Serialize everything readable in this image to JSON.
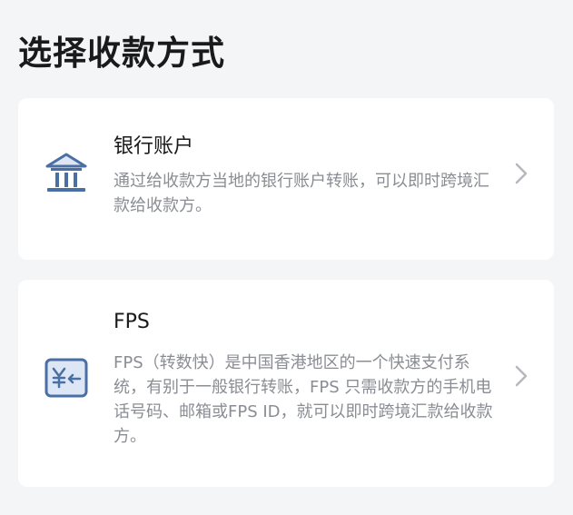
{
  "page": {
    "title": "选择收款方式"
  },
  "methods": [
    {
      "icon": "bank-icon",
      "title": "银行账户",
      "description": "通过给收款方当地的银行账户转账，可以即时跨境汇款给收款方。"
    },
    {
      "icon": "fps-yen-icon",
      "title": "FPS",
      "description": "FPS（转数快）是中国香港地区的一个快速支付系统，有别于一般银行转账，FPS 只需收款方的手机电话号码、邮箱或FPS ID，就可以即时跨境汇款给收款方。"
    }
  ],
  "colors": {
    "background": "#f4f5f7",
    "card": "#ffffff",
    "icon_stroke": "#4a6fa5",
    "icon_fill": "#dde6f5",
    "description": "#8a8d93",
    "chevron": "#b5b8be"
  }
}
